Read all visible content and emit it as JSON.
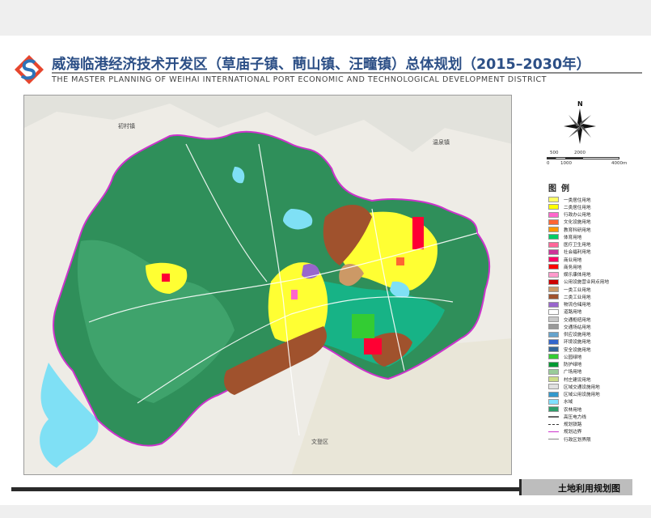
{
  "header": {
    "title_cn": "威海临港经济技术开发区（草庙子镇、蔄山镇、汪疃镇）总体规划（2015–2030年）",
    "title_en": "THE MASTER PLANNING OF WEIHAI INTERNATIONAL PORT ECONOMIC AND TECHNOLOGICAL DEVELOPMENT DISTRICT",
    "logo_icon": "company-logo-icon"
  },
  "map": {
    "place_labels": [
      "初村镇",
      "温泉镇",
      "文登区"
    ]
  },
  "compass": {
    "north_label": "N"
  },
  "scale": {
    "top_labels": [
      "500",
      "2000"
    ],
    "bottom_labels": [
      "0",
      "1000",
      "4000m"
    ]
  },
  "legend": {
    "title": "图例",
    "items": [
      {
        "label": "一类居住用地",
        "color": "#ffff66"
      },
      {
        "label": "二类居住用地",
        "color": "#ffff00"
      },
      {
        "label": "行政办公用地",
        "color": "#ff66cc"
      },
      {
        "label": "文化设施用地",
        "color": "#ff6633"
      },
      {
        "label": "教育科研用地",
        "color": "#ff9900"
      },
      {
        "label": "体育用地",
        "color": "#00cc66"
      },
      {
        "label": "医疗卫生用地",
        "color": "#ff6699"
      },
      {
        "label": "社会福利用地",
        "color": "#cc3399"
      },
      {
        "label": "商业用地",
        "color": "#ff0066"
      },
      {
        "label": "商务用地",
        "color": "#ff0000"
      },
      {
        "label": "娱乐康体用地",
        "color": "#ff99cc"
      },
      {
        "label": "公用设施营业网点用地",
        "color": "#cc0000"
      },
      {
        "label": "一类工业用地",
        "color": "#cc9966"
      },
      {
        "label": "二类工业用地",
        "color": "#a0522d"
      },
      {
        "label": "物流仓储用地",
        "color": "#9966cc"
      },
      {
        "label": "道路用地",
        "color": "#ffffff"
      },
      {
        "label": "交通枢纽用地",
        "color": "#c8c8c8"
      },
      {
        "label": "交通场站用地",
        "color": "#999999"
      },
      {
        "label": "供应设施用地",
        "color": "#66a3cc"
      },
      {
        "label": "环境设施用地",
        "color": "#3366cc"
      },
      {
        "label": "安全设施用地",
        "color": "#336699"
      },
      {
        "label": "公园绿地",
        "color": "#33cc33"
      },
      {
        "label": "防护绿地",
        "color": "#009933"
      },
      {
        "label": "广场用地",
        "color": "#99cc99"
      },
      {
        "label": "村庄建设用地",
        "color": "#ccdd88"
      },
      {
        "label": "区域交通设施用地",
        "color": "#e0e0e0"
      },
      {
        "label": "区域公用设施用地",
        "color": "#3399cc"
      },
      {
        "label": "水域",
        "color": "#80e0ff"
      },
      {
        "label": "农林用地",
        "color": "#2e9e6a"
      },
      {
        "label": "高压电力线",
        "color": "#666666"
      },
      {
        "label": "规划铁路",
        "color": "#333333"
      },
      {
        "label": "规划边界",
        "color": "#cc33cc"
      },
      {
        "label": "行政区划界限",
        "color": "#888888"
      }
    ]
  },
  "footer": {
    "label": "土地利用规划图"
  }
}
